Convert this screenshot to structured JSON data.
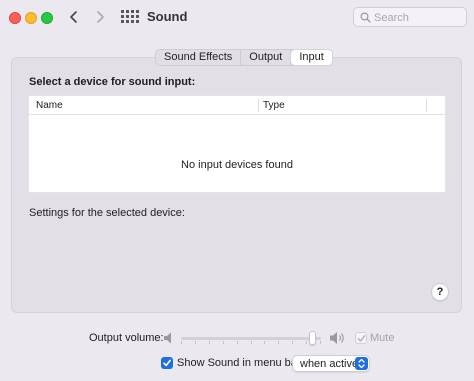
{
  "window": {
    "title": "Sound",
    "search": {
      "placeholder": "Search",
      "value": ""
    }
  },
  "tabs": [
    {
      "label": "Sound Effects",
      "active": false
    },
    {
      "label": "Output",
      "active": false
    },
    {
      "label": "Input",
      "active": true
    }
  ],
  "input_panel": {
    "section_title": "Select a device for sound input:",
    "table": {
      "columns": [
        "Name",
        "Type"
      ],
      "rows": [],
      "empty_message": "No input devices found"
    },
    "settings_label": "Settings for the selected device:",
    "help_label": "?"
  },
  "output_volume": {
    "label": "Output volume:",
    "level": 0.96,
    "mute_label": "Mute",
    "mute_checked": true,
    "mute_enabled": false
  },
  "menu_bar": {
    "show_sound_label": "Show Sound in menu bar",
    "show_sound_checked": true,
    "visibility_option": "when active"
  },
  "colors": {
    "accent": "#1e6fe0",
    "close": "#fe5f57",
    "minimize": "#febc2e",
    "maximize": "#28c840"
  },
  "icons": [
    "close-icon",
    "minimize-icon",
    "maximize-icon",
    "chevron-left-icon",
    "chevron-right-icon",
    "grid-icon",
    "search-icon",
    "speaker-low-icon",
    "speaker-high-icon",
    "checkmark-icon",
    "popup-arrows-icon"
  ]
}
